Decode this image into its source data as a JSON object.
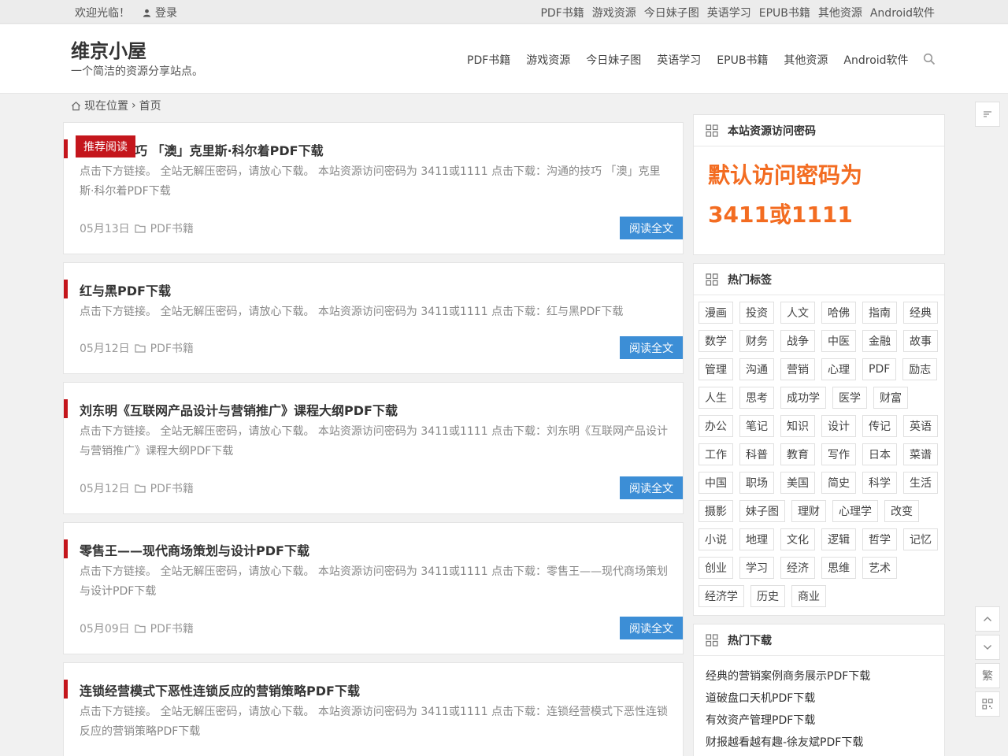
{
  "topbar": {
    "welcome": "欢迎光临！",
    "login": "登录",
    "nav": [
      "PDF书籍",
      "游戏资源",
      "今日妹子图",
      "英语学习",
      "EPUB书籍",
      "其他资源",
      "Android软件"
    ]
  },
  "header": {
    "site_title": "维京小屋",
    "site_desc": "一个简洁的资源分享站点。",
    "nav": [
      "PDF书籍",
      "游戏资源",
      "今日妹子图",
      "英语学习",
      "EPUB书籍",
      "其他资源",
      "Android软件"
    ]
  },
  "breadcrumb": {
    "label": "现在位置",
    "current": "首页"
  },
  "featured_badge": "推荐阅读",
  "read_more": "阅读全文",
  "posts": [
    {
      "title": "巧 「澳」克里斯·科尔着PDF下载",
      "excerpt": "点击下方链接。 全站无解压密码，请放心下载。 本站资源访问密码为 3411或1111 点击下载：沟通的技巧 「澳」克里斯·科尔着PDF下载",
      "date": "05月13日",
      "category": "PDF书籍"
    },
    {
      "title": "红与黑PDF下载",
      "excerpt": "点击下方链接。 全站无解压密码，请放心下载。 本站资源访问密码为 3411或1111 点击下载：红与黑PDF下载",
      "date": "05月12日",
      "category": "PDF书籍"
    },
    {
      "title": "刘东明《互联网产品设计与营销推广》课程大纲PDF下载",
      "excerpt": "点击下方链接。 全站无解压密码，请放心下载。 本站资源访问密码为 3411或1111 点击下载：刘东明《互联网产品设计与营销推广》课程大纲PDF下载",
      "date": "05月12日",
      "category": "PDF书籍"
    },
    {
      "title": "零售王——现代商场策划与设计PDF下载",
      "excerpt": "点击下方链接。 全站无解压密码，请放心下载。 本站资源访问密码为 3411或1111 点击下载：零售王——现代商场策划与设计PDF下载",
      "date": "05月09日",
      "category": "PDF书籍"
    },
    {
      "title": "连锁经营模式下恶性连锁反应的营销策略PDF下载",
      "excerpt": "点击下方链接。 全站无解压密码，请放心下载。 本站资源访问密码为 3411或1111 点击下载：连锁经营模式下恶性连锁反应的营销策略PDF下载"
    }
  ],
  "sidebar": {
    "password_widget": {
      "title": "本站资源访问密码",
      "line1": "默认访问密码为",
      "line2": "3411或1111"
    },
    "tags_widget": {
      "title": "热门标签",
      "tags": [
        "漫画",
        "投资",
        "人文",
        "哈佛",
        "指南",
        "经典",
        "数学",
        "财务",
        "战争",
        "中医",
        "金融",
        "故事",
        "管理",
        "沟通",
        "营销",
        "心理",
        "PDF",
        "励志",
        "人生",
        "思考",
        "成功学",
        "医学",
        "财富",
        "办公",
        "笔记",
        "知识",
        "设计",
        "传记",
        "英语",
        "工作",
        "科普",
        "教育",
        "写作",
        "日本",
        "菜谱",
        "中国",
        "职场",
        "美国",
        "简史",
        "科学",
        "生活",
        "摄影",
        "妹子图",
        "理财",
        "心理学",
        "改变",
        "小说",
        "地理",
        "文化",
        "逻辑",
        "哲学",
        "记忆",
        "创业",
        "学习",
        "经济",
        "思维",
        "艺术",
        "经济学",
        "历史",
        "商业"
      ]
    },
    "downloads_widget": {
      "title": "热门下载",
      "items": [
        "经典的营销案例商务展示PDF下载",
        "道破盘口天机PDF下载",
        "有效资产管理PDF下载",
        "财报越看越有趣-徐友斌PDF下载"
      ]
    }
  },
  "float_buttons": {
    "traditional": "繁"
  }
}
